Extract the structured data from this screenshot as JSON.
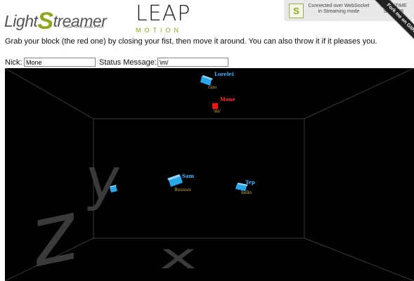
{
  "header": {
    "lightstreamer_logo": {
      "prefix": "Light",
      "s": "S",
      "suffix": "treamer",
      "tagline": "Real-Time Data Push"
    },
    "leap_logo": {
      "title": "LEAP",
      "subtitle": "MOTION"
    },
    "connection": {
      "status": "Connected over WebSocket in Streaming mode",
      "server": "REAL-TIME SERVER"
    },
    "ribbon": "Fork me on GitHub"
  },
  "instructions": "Grab your block (the red one) by closing your fist, then move it around. You can also throw it if it pleases you.",
  "form": {
    "nick_label": "Nick:",
    "nick_value": "Mone",
    "status_label": "Status Message:",
    "status_value": "\\m/"
  },
  "scene": {
    "axes": {
      "x": "x",
      "y": "y",
      "z": "z"
    },
    "players": [
      {
        "name": "Lorelei",
        "message": "ciao",
        "color": "#2aa7e8",
        "own": false
      },
      {
        "name": "Mone",
        "message": "\\m/",
        "color": "#ff1010",
        "own": true
      },
      {
        "name": "Sam",
        "message": "Buuuuu",
        "color": "#2aa7e8",
        "own": false
      },
      {
        "name": "Tep",
        "message": "hello",
        "color": "#2aa7e8",
        "own": false
      },
      {
        "name": "",
        "message": "",
        "color": "#2aa7e8",
        "own": false
      }
    ],
    "colors": {
      "background": "#000000",
      "room_lines": "#3a3a3a",
      "own_label": "#ff3030",
      "other_label": "#3fb4ff",
      "message": "#d4b04a"
    }
  }
}
